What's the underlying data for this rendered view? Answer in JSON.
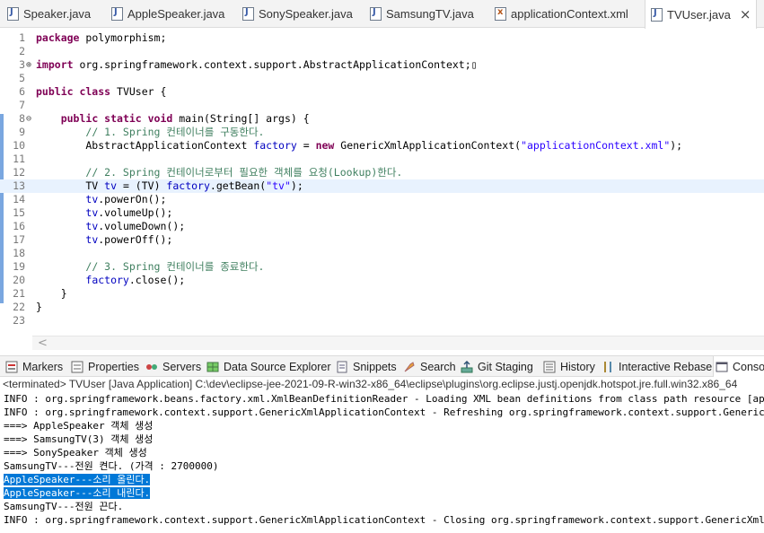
{
  "editor_tabs": [
    {
      "label": "Speaker.java",
      "icon": "java-file-icon",
      "active": false
    },
    {
      "label": "AppleSpeaker.java",
      "icon": "java-file-icon",
      "active": false
    },
    {
      "label": "SonySpeaker.java",
      "icon": "java-file-icon",
      "active": false
    },
    {
      "label": "SamsungTV.java",
      "icon": "java-file-icon",
      "active": false
    },
    {
      "label": "applicationContext.xml",
      "icon": "xml-file-icon",
      "active": false
    },
    {
      "label": "TVUser.java",
      "icon": "java-file-icon",
      "active": true,
      "close": "×"
    }
  ],
  "code": {
    "current_line": 13,
    "lines": [
      {
        "n": "1",
        "fold": "",
        "html": "<span class=\"kw\">package</span> polymorphism;"
      },
      {
        "n": "2",
        "fold": "",
        "html": ""
      },
      {
        "n": "3",
        "fold": "⊕",
        "html": "<span class=\"kw\">import</span> org.springframework.context.support.AbstractApplicationContext;▯"
      },
      {
        "n": "5",
        "fold": "",
        "html": ""
      },
      {
        "n": "6",
        "fold": "",
        "html": "<span class=\"kw\">public class</span> TVUser {"
      },
      {
        "n": "7",
        "fold": "",
        "html": ""
      },
      {
        "n": "8",
        "fold": "⊖",
        "html": "    <span class=\"kw\">public static void</span> main(String[] args) {"
      },
      {
        "n": "9",
        "fold": "",
        "html": "        <span class=\"cm\">// 1. Spring 컨테이너를 구동한다.</span>"
      },
      {
        "n": "10",
        "fold": "",
        "html": "        AbstractApplicationContext <span class=\"fld\">factory</span> = <span class=\"kw\">new</span> GenericXmlApplicationContext(<span class=\"str\">\"applicationContext.xml\"</span>);"
      },
      {
        "n": "11",
        "fold": "",
        "html": ""
      },
      {
        "n": "12",
        "fold": "",
        "html": "        <span class=\"cm\">// 2. Spring 컨테이너로부터 필요한 객체를 요청(Lookup)한다.</span>"
      },
      {
        "n": "13",
        "fold": "",
        "html": "        TV <span class=\"fld\">tv</span> = (TV) <span class=\"fld\">factory</span>.getBean(<span class=\"str\">\"tv\"</span>);"
      },
      {
        "n": "14",
        "fold": "",
        "html": "        <span class=\"fld\">tv</span>.powerOn();"
      },
      {
        "n": "15",
        "fold": "",
        "html": "        <span class=\"fld\">tv</span>.volumeUp();"
      },
      {
        "n": "16",
        "fold": "",
        "html": "        <span class=\"fld\">tv</span>.volumeDown();"
      },
      {
        "n": "17",
        "fold": "",
        "html": "        <span class=\"fld\">tv</span>.powerOff();"
      },
      {
        "n": "18",
        "fold": "",
        "html": ""
      },
      {
        "n": "19",
        "fold": "",
        "html": "        <span class=\"cm\">// 3. Spring 컨테이너를 종료한다.</span>"
      },
      {
        "n": "20",
        "fold": "",
        "html": "        <span class=\"fld\">factory</span>.close();"
      },
      {
        "n": "21",
        "fold": "",
        "html": "    }"
      },
      {
        "n": "22",
        "fold": "",
        "html": "}"
      },
      {
        "n": "23",
        "fold": "",
        "html": ""
      }
    ]
  },
  "editor_scroll_arrow": "<",
  "view_tabs": [
    {
      "label": "Markers",
      "icon": "markers-icon"
    },
    {
      "label": "Properties",
      "icon": "properties-icon"
    },
    {
      "label": "Servers",
      "icon": "servers-icon"
    },
    {
      "label": "Data Source Explorer",
      "icon": "data-source-icon"
    },
    {
      "label": "Snippets",
      "icon": "snippets-icon"
    },
    {
      "label": "Search",
      "icon": "search-icon"
    },
    {
      "label": "Git Staging",
      "icon": "git-staging-icon"
    },
    {
      "label": "History",
      "icon": "history-icon"
    },
    {
      "label": "Interactive Rebase",
      "icon": "rebase-icon"
    },
    {
      "label": "Console",
      "icon": "console-icon",
      "active": true
    }
  ],
  "console": {
    "header": "<terminated> TVUser [Java Application] C:\\dev\\eclipse-jee-2021-09-R-win32-x86_64\\eclipse\\plugins\\org.eclipse.justj.openjdk.hotspot.jre.full.win32.x86_64",
    "lines": [
      {
        "text": "INFO : org.springframework.beans.factory.xml.XmlBeanDefinitionReader - Loading XML bean definitions from class path resource [applicationContext.xml]",
        "selected": false
      },
      {
        "text": "INFO : org.springframework.context.support.GenericXmlApplicationContext - Refreshing org.springframework.context.support.GenericXmlApplicationContext",
        "selected": false
      },
      {
        "text": "===> AppleSpeaker 객체 생성",
        "selected": false
      },
      {
        "text": "===> SamsungTV(3) 객체 생성",
        "selected": false
      },
      {
        "text": "===> SonySpeaker 객체 생성",
        "selected": false
      },
      {
        "text": "SamsungTV---전원 켠다. (가격 : 2700000)",
        "selected": false
      },
      {
        "text": "AppleSpeaker---소리 올린다.",
        "selected": true
      },
      {
        "text": "AppleSpeaker---소리 내린다.",
        "selected": true
      },
      {
        "text": "SamsungTV---전원 끈다.",
        "selected": false
      },
      {
        "text": "INFO : org.springframework.context.support.GenericXmlApplicationContext - Closing org.springframework.context.support.GenericXmlApplicationContext",
        "selected": false
      }
    ]
  },
  "colors": {
    "selection": "#0078d7",
    "keyword": "#7f0055",
    "comment": "#3f7f5f",
    "string": "#2a00ff",
    "field": "#0000c0"
  }
}
